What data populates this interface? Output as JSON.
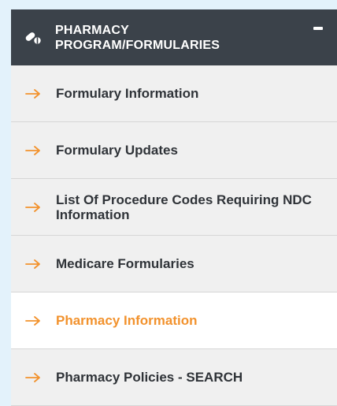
{
  "accent_color": "#f2922d",
  "header_color": "#3b424a",
  "header": {
    "icon": "pills-icon",
    "title": "PHARMACY PROGRAM/FORMULARIES",
    "collapse_icon": "minus-icon"
  },
  "items": [
    {
      "label": "Formulary Information",
      "icon": "arrow-right-icon",
      "active": false
    },
    {
      "label": "Formulary Updates",
      "icon": "arrow-right-icon",
      "active": false
    },
    {
      "label": "List Of Procedure Codes Requiring NDC Information",
      "icon": "arrow-right-icon",
      "active": false
    },
    {
      "label": "Medicare Formularies",
      "icon": "arrow-right-icon",
      "active": false
    },
    {
      "label": "Pharmacy Information",
      "icon": "arrow-right-icon",
      "active": true
    },
    {
      "label": "Pharmacy Policies - SEARCH",
      "icon": "arrow-right-icon",
      "active": false
    }
  ]
}
